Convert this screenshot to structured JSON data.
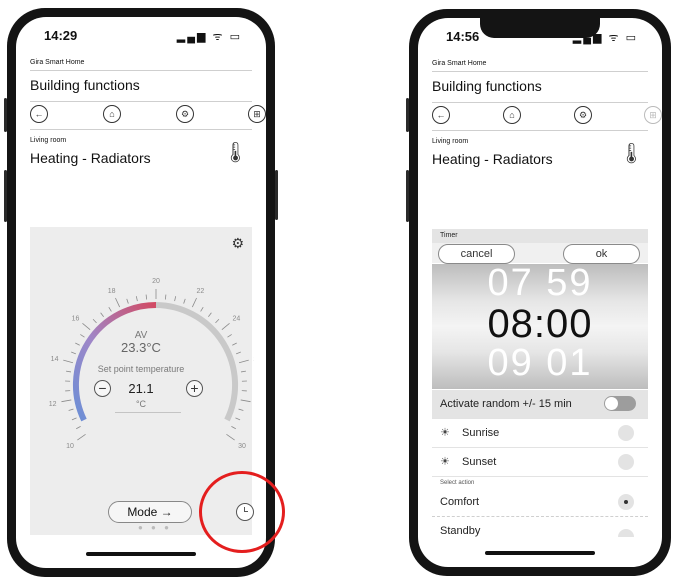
{
  "left": {
    "status": {
      "time": "14:29",
      "icons": "▂▄▆ ᯤ ▭"
    },
    "app_label": "Gira Smart Home",
    "section_title": "Building functions",
    "nav": {
      "back": "←",
      "home": "⌂",
      "settings": "⚙",
      "grid": "⊞"
    },
    "room_label": "Living room",
    "page_title": "Heating - Radiators",
    "thermometer_icon": "🌡",
    "thermostat": {
      "gear": "⚙",
      "scale_labels": [
        "10",
        "12",
        "14",
        "16",
        "18",
        "20",
        "22",
        "24",
        "26",
        "28",
        "30"
      ],
      "actual_label": "AV",
      "actual_value": "23.3°C",
      "setpoint_label": "Set point temperature",
      "setpoint_value": "21.1",
      "unit": "°C",
      "minus": "−",
      "plus": "+",
      "mode_button": "Mode  →",
      "page_dots": "● ● ●"
    }
  },
  "right": {
    "status": {
      "time": "14:56",
      "icons": "▂▄▆ ᯤ ▭"
    },
    "app_label": "Gira Smart Home",
    "section_title": "Building functions",
    "nav": {
      "back": "←",
      "home": "⌂",
      "settings": "⚙",
      "grid": "⊞"
    },
    "room_label": "Living room",
    "page_title": "Heating - Radiators",
    "thermometer_icon": "🌡",
    "timer": {
      "header": "Timer",
      "cancel": "cancel",
      "ok": "ok",
      "prev_time": "07 59",
      "selected_time": "08:00",
      "next_time": "09 01",
      "random_label": "Activate random +/- 15 min",
      "sunrise": "Sunrise",
      "sunset": "Sunset",
      "select_action": "Select action",
      "comfort": "Comfort",
      "standby": "Standby"
    }
  }
}
